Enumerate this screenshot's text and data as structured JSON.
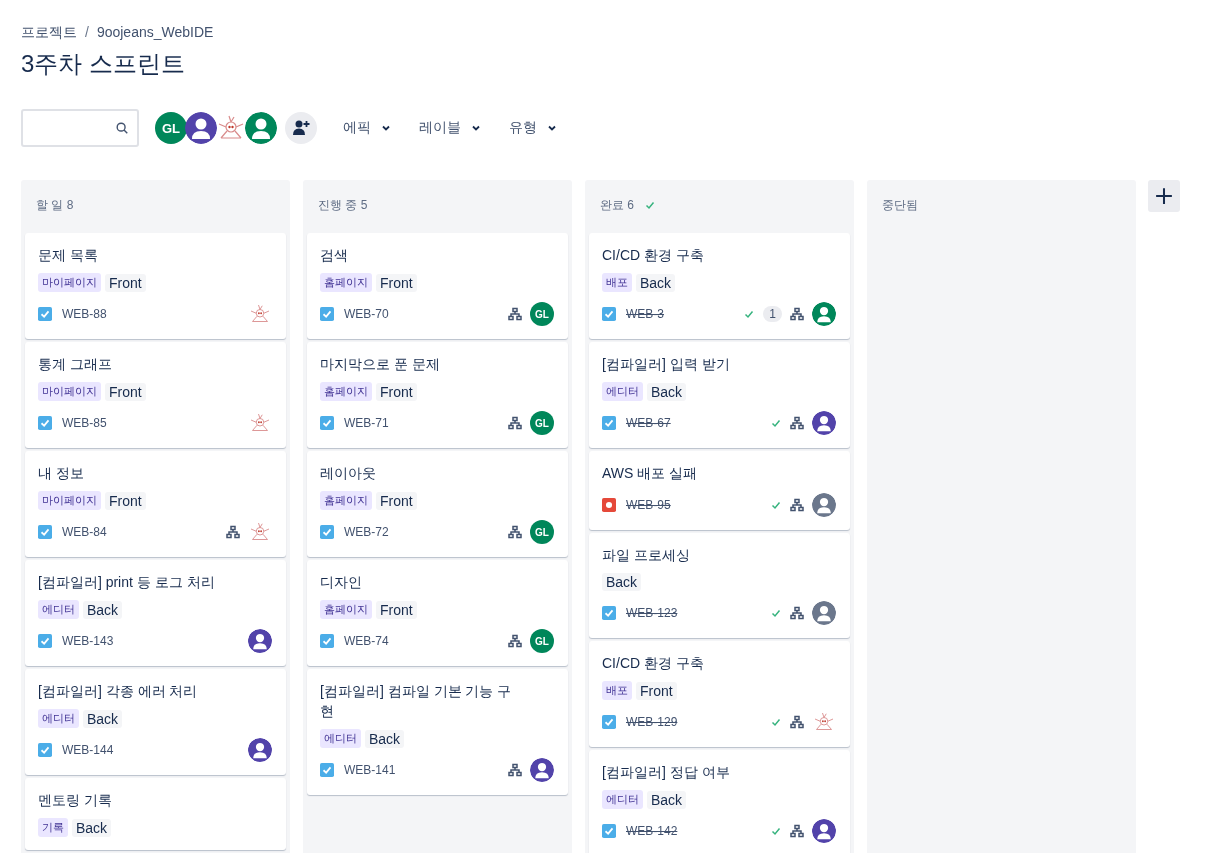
{
  "breadcrumb": [
    "프로젝트",
    "9oojeans_WebIDE"
  ],
  "breadcrumb_separator": "/",
  "title": "3주차 스프린트",
  "members": [
    {
      "kind": "initials",
      "text": "GL",
      "color": "#00875a"
    },
    {
      "kind": "person",
      "color": "#5243aa"
    },
    {
      "kind": "doodle"
    },
    {
      "kind": "person",
      "color": "#00875a"
    }
  ],
  "filters": [
    "에픽",
    "레이블",
    "유형"
  ],
  "columns": [
    {
      "title": "할 일 8",
      "done_mark": false,
      "cards": [
        {
          "title": "문제 목록",
          "epic": "마이페이지",
          "labels": [
            "Front"
          ],
          "kind": "task",
          "key": "WEB-88",
          "done": false,
          "subtasks": false,
          "assignee": {
            "kind": "doodle"
          }
        },
        {
          "title": "통계 그래프",
          "epic": "마이페이지",
          "labels": [
            "Front"
          ],
          "kind": "task",
          "key": "WEB-85",
          "done": false,
          "subtasks": false,
          "assignee": {
            "kind": "doodle"
          }
        },
        {
          "title": "내 정보",
          "epic": "마이페이지",
          "labels": [
            "Front"
          ],
          "kind": "task",
          "key": "WEB-84",
          "done": false,
          "subtasks": true,
          "assignee": {
            "kind": "doodle"
          }
        },
        {
          "title": "[컴파일러] print 등 로그 처리",
          "epic": "에디터",
          "labels": [
            "Back"
          ],
          "kind": "task",
          "key": "WEB-143",
          "done": false,
          "subtasks": false,
          "assignee": {
            "kind": "person",
            "color": "#5243aa"
          }
        },
        {
          "title": "[컴파일러] 각종 에러 처리",
          "epic": "에디터",
          "labels": [
            "Back"
          ],
          "kind": "task",
          "key": "WEB-144",
          "done": false,
          "subtasks": false,
          "assignee": {
            "kind": "person",
            "color": "#5243aa"
          }
        },
        {
          "title": "멘토링 기록",
          "epic": "기록",
          "labels": [
            "Back"
          ]
        }
      ]
    },
    {
      "title": "진행 중 5",
      "done_mark": false,
      "cards": [
        {
          "title": "검색",
          "epic": "홈페이지",
          "labels": [
            "Front"
          ],
          "kind": "task",
          "key": "WEB-70",
          "done": false,
          "subtasks": true,
          "assignee": {
            "kind": "initials",
            "text": "GL",
            "color": "#00875a"
          }
        },
        {
          "title": "마지막으로 푼 문제",
          "epic": "홈페이지",
          "labels": [
            "Front"
          ],
          "kind": "task",
          "key": "WEB-71",
          "done": false,
          "subtasks": true,
          "assignee": {
            "kind": "initials",
            "text": "GL",
            "color": "#00875a"
          }
        },
        {
          "title": "레이아웃",
          "epic": "홈페이지",
          "labels": [
            "Front"
          ],
          "kind": "task",
          "key": "WEB-72",
          "done": false,
          "subtasks": true,
          "assignee": {
            "kind": "initials",
            "text": "GL",
            "color": "#00875a"
          }
        },
        {
          "title": "디자인",
          "epic": "홈페이지",
          "labels": [
            "Front"
          ],
          "kind": "task",
          "key": "WEB-74",
          "done": false,
          "subtasks": true,
          "assignee": {
            "kind": "initials",
            "text": "GL",
            "color": "#00875a"
          }
        },
        {
          "title": "[컴파일러] 컴파일 기본 기능 구현",
          "epic": "에디터",
          "labels": [
            "Back"
          ],
          "kind": "task",
          "key": "WEB-141",
          "done": false,
          "subtasks": true,
          "assignee": {
            "kind": "person",
            "color": "#5243aa"
          }
        }
      ]
    },
    {
      "title": "완료 6",
      "done_mark": true,
      "cards": [
        {
          "title": "CI/CD 환경 구축",
          "epic": "배포",
          "labels": [
            "Back"
          ],
          "kind": "task",
          "key": "WEB-3",
          "done": true,
          "comments": "1",
          "subtasks": true,
          "assignee": {
            "kind": "person",
            "color": "#00875a"
          }
        },
        {
          "title": "[컴파일러] 입력 받기",
          "epic": "에디터",
          "labels": [
            "Back"
          ],
          "kind": "task",
          "key": "WEB-67",
          "done": true,
          "subtasks": true,
          "assignee": {
            "kind": "person",
            "color": "#5243aa"
          }
        },
        {
          "title": "AWS 배포 실패",
          "kind": "bug",
          "key": "WEB-95",
          "done": true,
          "subtasks": true,
          "assignee": {
            "kind": "person",
            "color": "#6b778c"
          }
        },
        {
          "title": "파일 프로세싱",
          "labels": [
            "Back"
          ],
          "kind": "task",
          "key": "WEB-123",
          "done": true,
          "subtasks": true,
          "assignee": {
            "kind": "person",
            "color": "#6b778c"
          }
        },
        {
          "title": "CI/CD 환경 구축",
          "epic": "배포",
          "labels": [
            "Front"
          ],
          "kind": "task",
          "key": "WEB-129",
          "done": true,
          "subtasks": true,
          "assignee": {
            "kind": "doodle"
          }
        },
        {
          "title": "[컴파일러] 정답 여부",
          "epic": "에디터",
          "labels": [
            "Back"
          ],
          "kind": "task",
          "key": "WEB-142",
          "done": true,
          "subtasks": true,
          "assignee": {
            "kind": "person",
            "color": "#5243aa"
          }
        }
      ]
    },
    {
      "title": "중단됨",
      "done_mark": false
    }
  ]
}
